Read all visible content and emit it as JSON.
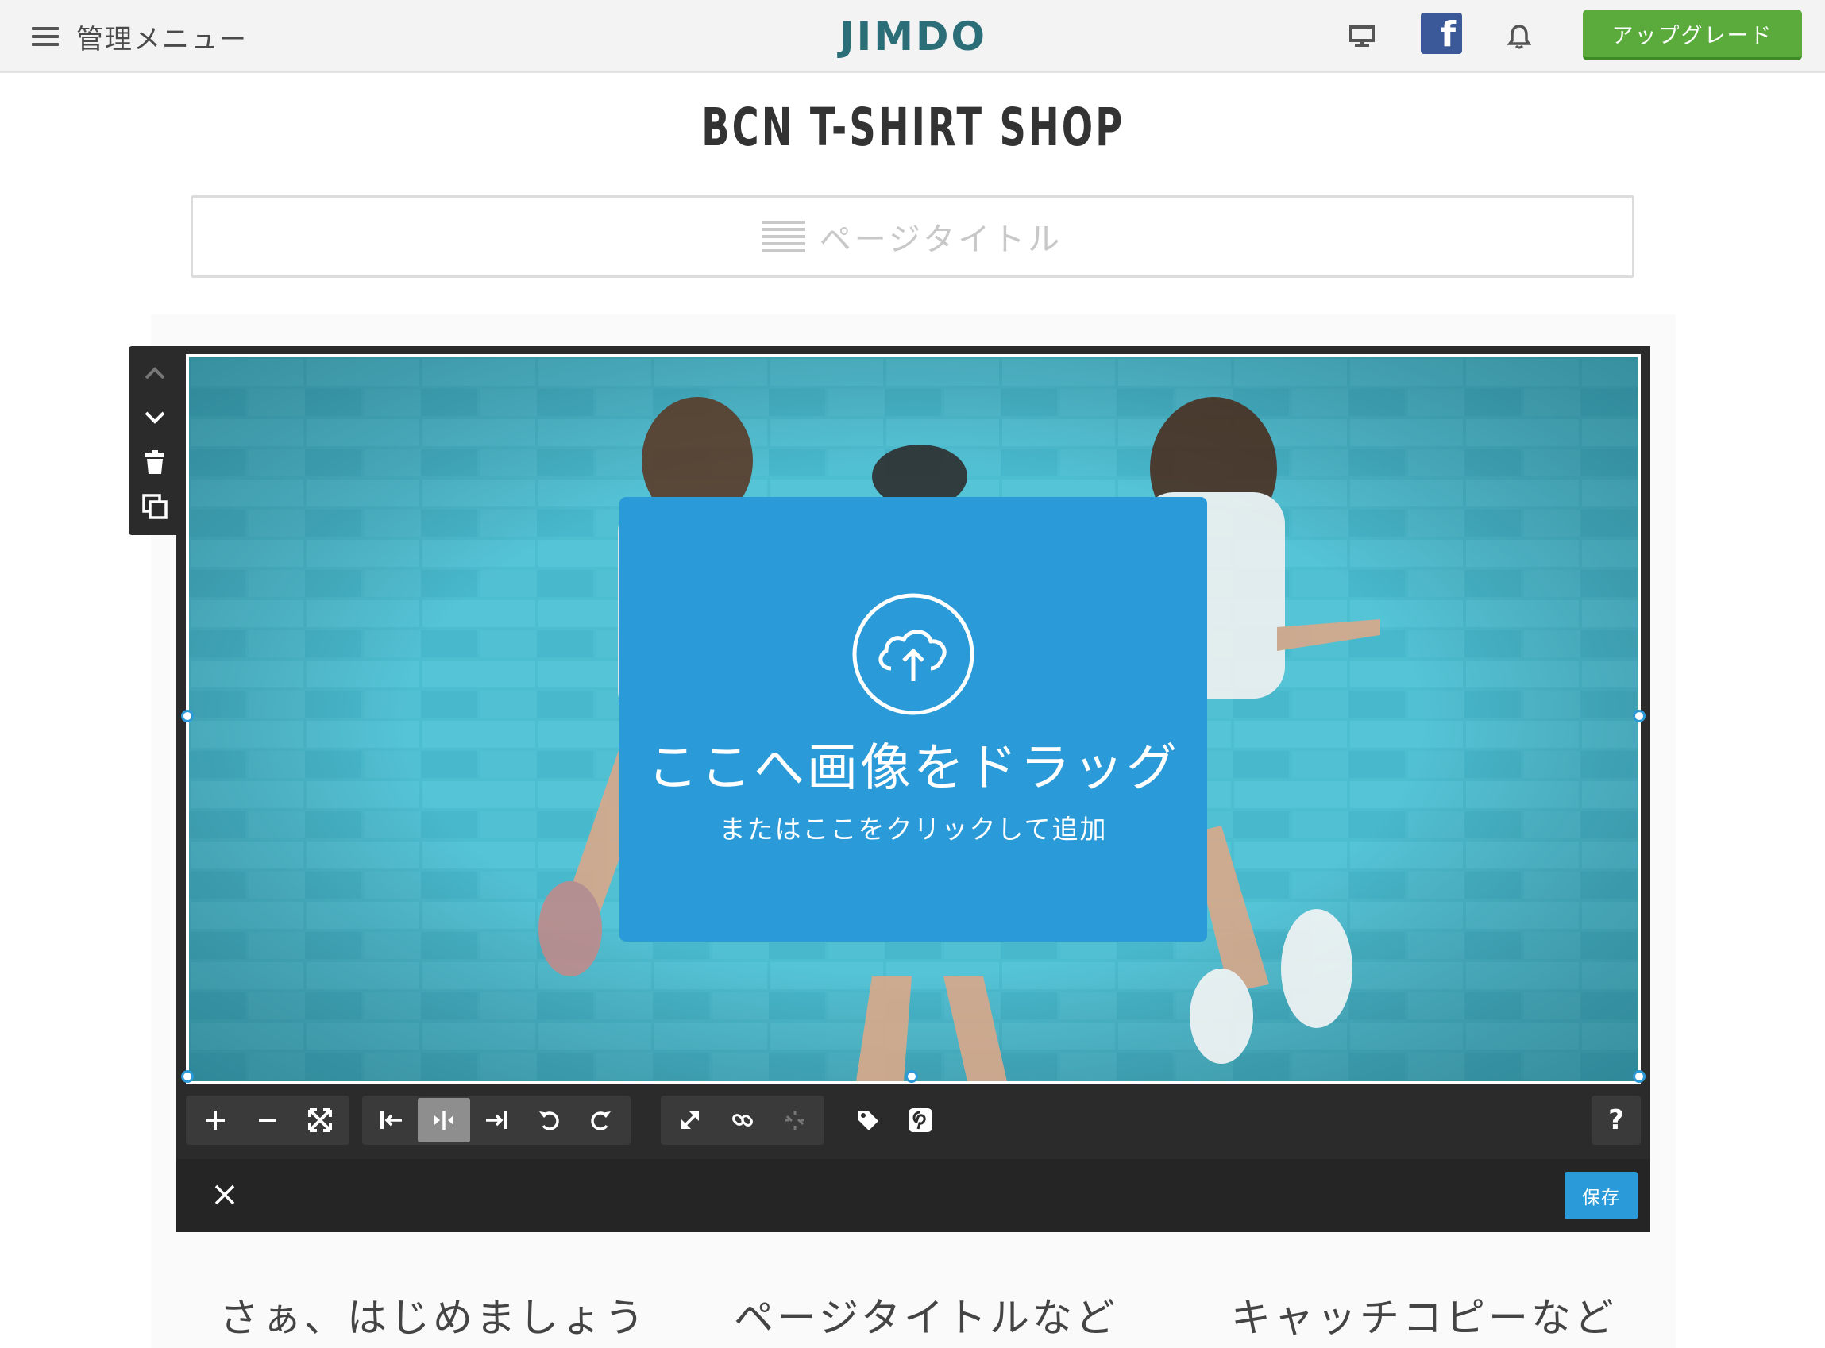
{
  "topbar": {
    "menu_label": "管理メニュー",
    "brand": "JIMDO",
    "facebook_glyph": "f",
    "upgrade_label": "アップグレード",
    "icons": [
      "hamburger-icon",
      "monitor-icon",
      "facebook-icon",
      "bell-icon"
    ]
  },
  "site": {
    "title": "BCN T-SHIRT SHOP",
    "page_title_placeholder": "ページタイトル"
  },
  "image_module": {
    "side_tools": [
      "chevron-up-icon",
      "chevron-down-icon",
      "trash-icon",
      "duplicate-icon"
    ],
    "upload_title": "ここへ画像をドラッグ",
    "upload_subtitle": "またはここをクリックして追加",
    "toolbar_groups": [
      [
        "zoom-in-icon",
        "zoom-out-icon",
        "fit-icon"
      ],
      [
        "align-left-icon",
        "align-center-icon",
        "align-right-icon",
        "rotate-left-icon",
        "rotate-right-icon"
      ],
      [
        "expand-icon",
        "link-icon",
        "unlink-icon"
      ],
      [
        "tag-icon",
        "pinterest-icon"
      ]
    ],
    "active_tool": "align-center-icon",
    "help_label": "?",
    "save_label": "保存"
  },
  "columns": [
    "さぁ、はじめましょう",
    "ページタイトルなど",
    "キャッチコピーなど"
  ],
  "colors": {
    "topbar_bg": "#f3f3f4",
    "brand": "#2b6e78",
    "upgrade": "#5aaa3c",
    "facebook": "#3b5998",
    "accent_blue": "#2a9bd8",
    "toolbar_dark": "#2b2b2b",
    "photo_wall": "#3fb1c6"
  }
}
